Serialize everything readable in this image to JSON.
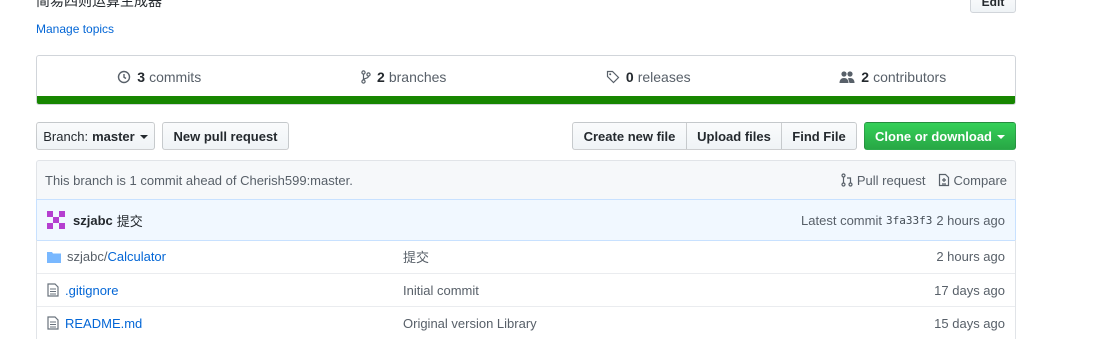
{
  "repo": {
    "description": "简易四则运算生成器",
    "edit_label": "Edit",
    "manage_topics": "Manage topics"
  },
  "summary": {
    "commits": {
      "count": "3",
      "label": "commits"
    },
    "branches": {
      "count": "2",
      "label": "branches"
    },
    "releases": {
      "count": "0",
      "label": "releases"
    },
    "contributors": {
      "count": "2",
      "label": "contributors"
    },
    "language_color": "#178600"
  },
  "toolbar": {
    "branch_prefix": "Branch:",
    "branch_name": "master",
    "new_pull_request": "New pull request",
    "create_new_file": "Create new file",
    "upload_files": "Upload files",
    "find_file": "Find File",
    "clone_or_download": "Clone or download"
  },
  "ahead": {
    "text": "This branch is 1 commit ahead of Cherish599:master.",
    "pull_request": "Pull request",
    "compare": "Compare"
  },
  "latest_commit": {
    "author": "szjabc",
    "message": "提交",
    "label": "Latest commit",
    "sha": "3fa33f3",
    "age": "2 hours ago"
  },
  "files": [
    {
      "icon": "folder-icon",
      "dir": "szjabc/",
      "name": "Calculator",
      "message": "提交",
      "age": "2 hours ago"
    },
    {
      "icon": "file-icon",
      "dir": "",
      "name": ".gitignore",
      "message": "Initial commit",
      "age": "17 days ago"
    },
    {
      "icon": "file-icon",
      "dir": "",
      "name": "README.md",
      "message": "Original version Library",
      "age": "15 days ago"
    }
  ]
}
